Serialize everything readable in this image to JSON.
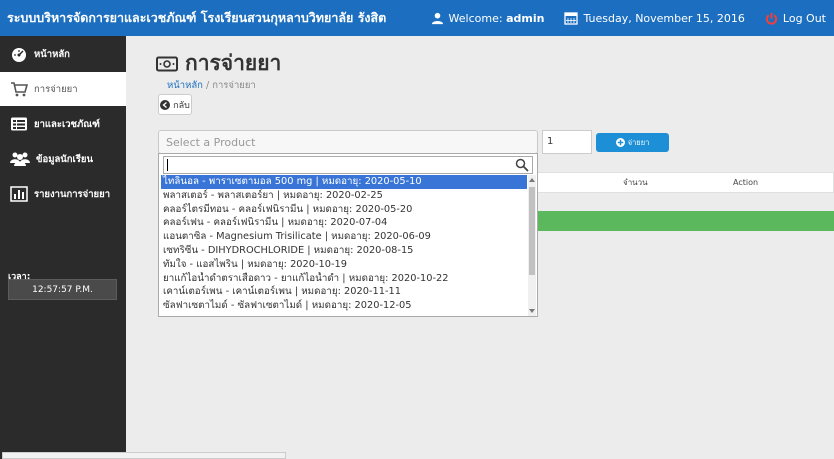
{
  "header": {
    "brand": "ระบบบริหารจัดการยาและเวชภัณฑ์ โรงเรียนสวนกุหลาบวิทยาลัย รังสิต",
    "welcome_prefix": "Welcome:",
    "username": "admin",
    "date": "Tuesday, November 15, 2016",
    "logout": "Log Out"
  },
  "sidebar": {
    "items": [
      {
        "label": "หน้าหลัก",
        "icon": "dashboard-icon"
      },
      {
        "label": "การจ่ายยา",
        "icon": "cart-icon"
      },
      {
        "label": "ยาและเวชภัณฑ์",
        "icon": "list-icon"
      },
      {
        "label": "ข้อมูลนักเรียน",
        "icon": "users-icon"
      },
      {
        "label": "รายงานการจ่ายยา",
        "icon": "bar-chart-icon"
      }
    ],
    "time_label": "เวลา:",
    "clock": "12:57:57 P.M."
  },
  "main": {
    "title": "การจ่ายยา",
    "breadcrumb_home": "หน้าหลัก",
    "breadcrumb_sep": " / ",
    "breadcrumb_current": "การจ่ายยา",
    "back_label": "กลับ",
    "product_placeholder": "Select a Product",
    "quantity": "1",
    "dispense_label": "จ่ายยา",
    "table_headers": {
      "qty": "จำนวน",
      "action": "Action"
    }
  },
  "dropdown": {
    "search_value": "",
    "options": [
      "ไทลินอล - พาราเซตามอล 500 mg | หมดอายุ: 2020-05-10",
      "พลาสเตอร์ - พลาสเตอร์ยา | หมดอายุ: 2020-02-25",
      "คลอร์ไตรมีทอน - คลอร์เฟนิรามีน | หมดอายุ: 2020-05-20",
      "คลอร์เฟน - คลอร์เฟนิรามีน | หมดอายุ: 2020-07-04",
      "แอนตาซิล - Magnesium Trisilicate | หมดอายุ: 2020-06-09",
      "เซทริซีน - DIHYDROCHLORIDE | หมดอายุ: 2020-08-15",
      "ทัมใจ - แอสไพริน | หมดอายุ: 2020-10-19",
      "ยาแก้ไอน้ำดำตราเสือดาว - ยาแก้ไอน้ำดำ | หมดอายุ: 2020-10-22",
      "เคาน์เตอร์เพน - เคาน์เตอร์เพน | หมดอายุ: 2020-11-11",
      "ซัลฟาเซตาไมด์ - ซัลฟาเซตาไมด์ | หมดอายุ: 2020-12-05"
    ],
    "selected_index": 0
  },
  "colors": {
    "topbar": "#1c6fc0",
    "sidebar": "#2b2b2b",
    "selected_option": "#3875d7",
    "dispense_button": "#1c8fd6",
    "green_bar": "#5cb85c",
    "logout_icon": "#ff3b30"
  }
}
